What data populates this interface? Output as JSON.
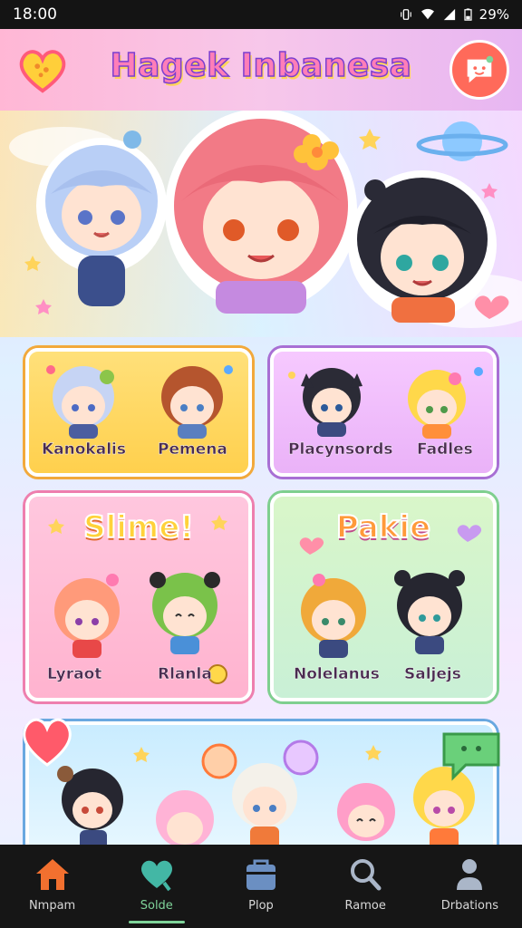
{
  "status_bar": {
    "time": "18:00",
    "battery": "29%"
  },
  "header": {
    "title": "Hagek Inbanesa",
    "left_icon": "heart-icon",
    "right_icon": "chat-bubble-icon"
  },
  "cards": [
    {
      "id": "card1",
      "labels": [
        "Kanokalis",
        "Pemena"
      ]
    },
    {
      "id": "card2",
      "labels": [
        "Placynsords",
        "Fadles"
      ]
    },
    {
      "id": "card3",
      "title": "Slime!",
      "labels": [
        "Lyraot",
        "Rlanla"
      ]
    },
    {
      "id": "card4",
      "title": "Pakie",
      "labels": [
        "Nolelanus",
        "Saljejs"
      ]
    },
    {
      "id": "card5",
      "labels": []
    }
  ],
  "nav": {
    "items": [
      {
        "label": "Nmpam",
        "icon": "home-icon",
        "active": false,
        "color": "#f2702f"
      },
      {
        "label": "Solde",
        "icon": "heart-icon",
        "active": true,
        "color": "#43b7a5"
      },
      {
        "label": "Plop",
        "icon": "bag-icon",
        "active": false,
        "color": "#6b8fc2"
      },
      {
        "label": "Ramoe",
        "icon": "search-icon",
        "active": false,
        "color": "#aab6c8"
      },
      {
        "label": "Drbations",
        "icon": "user-icon",
        "active": false,
        "color": "#aab6c8"
      }
    ]
  },
  "colors": {
    "accent_pink": "#ff7eb8",
    "title_stroke": "#7a3fd0",
    "nav_active": "#7fd49a"
  }
}
